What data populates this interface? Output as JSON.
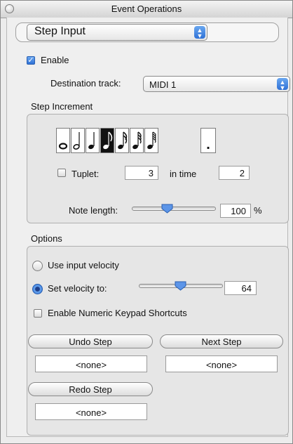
{
  "window": {
    "title": "Event Operations"
  },
  "mode": {
    "selected": "Step Input"
  },
  "enable": {
    "label": "Enable",
    "checked": true
  },
  "destination": {
    "label": "Destination track:",
    "value": "MIDI 1"
  },
  "step_increment": {
    "heading": "Step Increment",
    "note_icons": [
      "whole-note-icon",
      "half-note-icon",
      "quarter-note-icon",
      "eighth-note-icon",
      "sixteenth-note-icon",
      "thirty-second-note-icon",
      "sixty-fourth-note-icon"
    ],
    "selected_note_index": 3,
    "dot_label": ".",
    "tuplet_label": "Tuplet:",
    "tuplet_checked": false,
    "tuplet_value": "3",
    "in_time_label": "in time",
    "in_time_value": "2",
    "note_length_label": "Note length:",
    "note_length_value": "100",
    "note_length_unit": "%",
    "note_length_slider_fraction": 0.42
  },
  "options": {
    "heading": "Options",
    "use_input_velocity_label": "Use input velocity",
    "use_input_velocity_selected": false,
    "set_velocity_label": "Set velocity to:",
    "set_velocity_selected": true,
    "velocity_value": "64",
    "velocity_slider_fraction": 0.5,
    "numeric_keypad_label": "Enable Numeric Keypad Shortcuts",
    "numeric_keypad_checked": false
  },
  "buttons": {
    "undo_label": "Undo Step",
    "undo_value": "<none>",
    "next_label": "Next Step",
    "next_value": "<none>",
    "redo_label": "Redo Step",
    "redo_value": "<none>"
  },
  "colors": {
    "accent": "#2f71d6",
    "selected_note": "#111111"
  }
}
